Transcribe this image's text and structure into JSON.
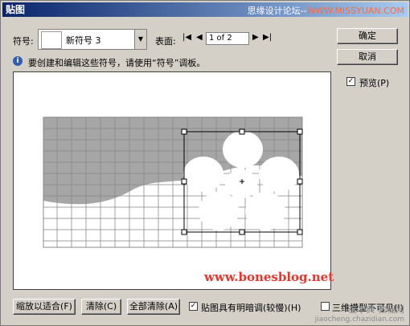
{
  "window": {
    "title": "贴图"
  },
  "watermark_top": {
    "text_gray": "思缘设计论坛",
    "text_site": "WWW.MISSYUAN.COM"
  },
  "symbol": {
    "label": "符号:",
    "selected": "新符号 3"
  },
  "surface": {
    "label": "表面:",
    "page": "1 of 2"
  },
  "info": {
    "text": "要创建和编辑这些符号，请使用“符号”调板。"
  },
  "buttons": {
    "ok": "确定",
    "cancel": "取消",
    "fit": "缩放以适合(F)",
    "clear": "清除(C)",
    "clear_all": "全部清除(A)"
  },
  "preview_toggle": {
    "label": "预览(P)",
    "checked": true
  },
  "shade_option": {
    "label": "贴图具有明暗调(较慢)(H)",
    "checked": true
  },
  "third_option": {
    "label": "三维模型不可见(I)",
    "checked": false
  },
  "watermarks": {
    "site": "www.bonesblog.net",
    "bottom1": "查字典 教程网",
    "bottom2": "jiaocheng.chazidian.com"
  },
  "colors": {
    "title_from": "#0a246a",
    "title_to": "#a6caf0",
    "panel": "#d4d0c8",
    "grid_dark": "#a0a0a0",
    "watermark_red": "#e8342a"
  }
}
